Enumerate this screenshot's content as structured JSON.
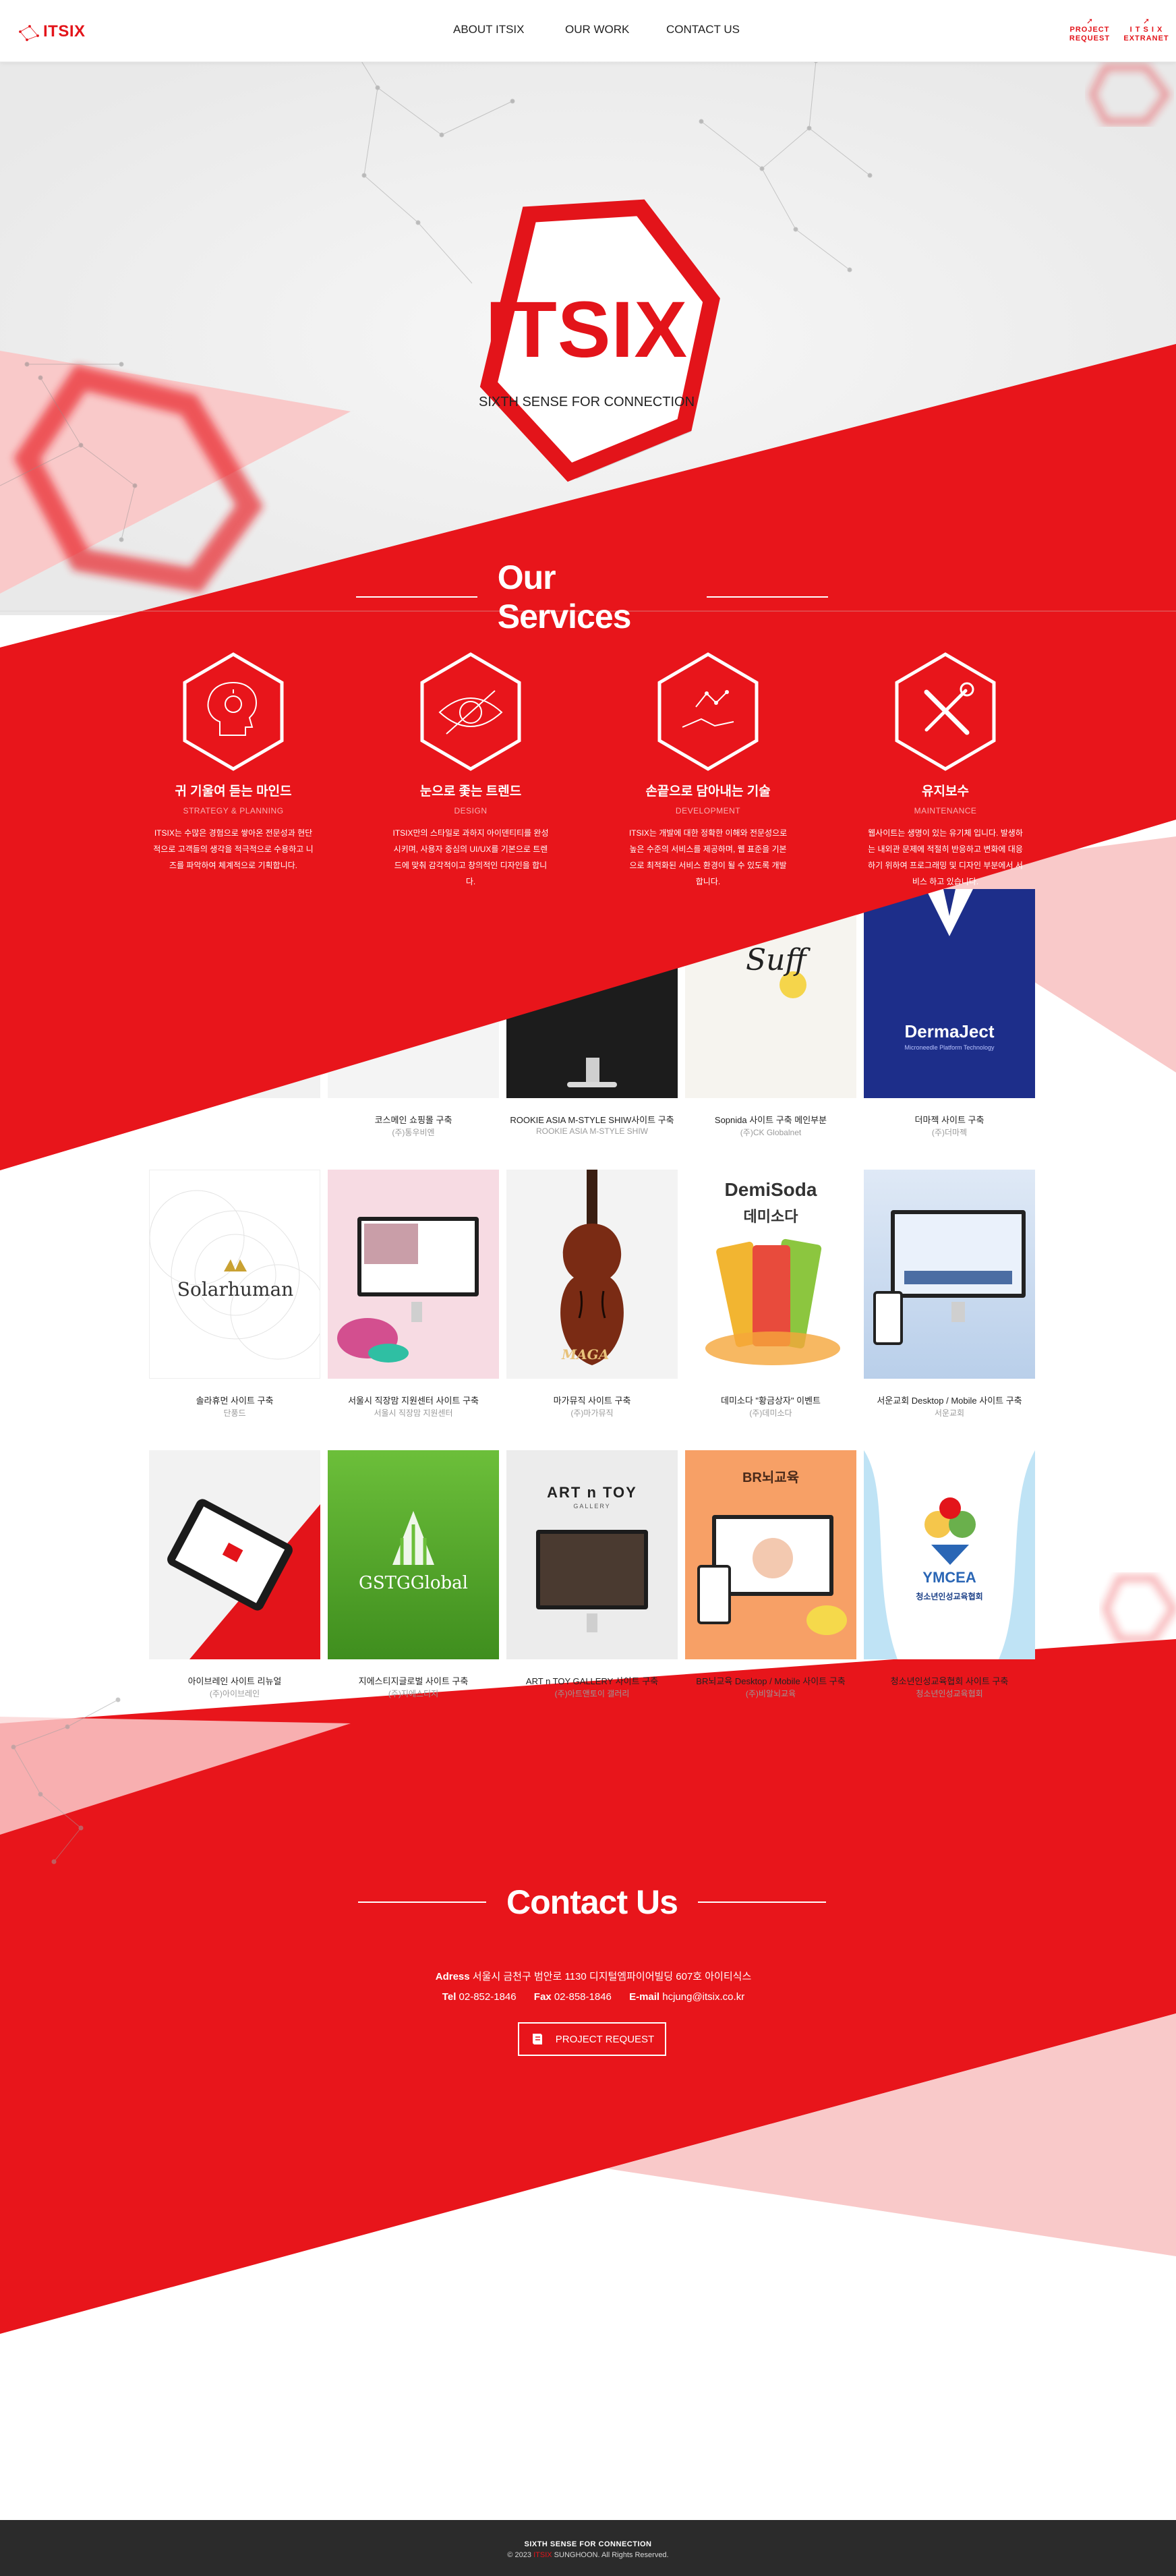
{
  "brand": {
    "logo_text": "ITSIX",
    "accent": "#e3141a",
    "light_red": "#f9c5c5"
  },
  "nav": {
    "items": [
      "ABOUT ITSIX",
      "OUR WORK",
      "CONTACT US"
    ]
  },
  "header_buttons": {
    "project_request": {
      "line1": "PROJECT",
      "line2": "REQUEST",
      "icon": "pointer-icon"
    },
    "extranet": {
      "line1": "I T S I X",
      "line2": "EXTRANET",
      "icon": "pointer-icon"
    }
  },
  "hero": {
    "title": "ITSIX",
    "subtitle": "SIXTH SENSE FOR CONNECTION"
  },
  "services": {
    "title": "Our Services",
    "items": [
      {
        "title": "귀 기울여 듣는 마인드",
        "subtitle": "STRATEGY & PLANNING",
        "icon": "head-idea-icon",
        "desc": "ITSIX는 수많은 경험으로 쌓아온 전문성과 현단적으로 고객들의 생각을 적극적으로 수용하고 니즈를 파악하여 체계적으로 기획합니다."
      },
      {
        "title": "눈으로 좇는 트렌드",
        "subtitle": "DESIGN",
        "icon": "eye-icon",
        "desc": "ITSIX만의 스타일로 과하지 아이덴티티를 완성시키며, 사용자 중심의 UI/UX를 기본으로 트렌드에 맞춰 감각적이고 창의적인 디자인을 합니다."
      },
      {
        "title": "손끝으로 담아내는 기술",
        "subtitle": "DEVELOPMENT",
        "icon": "hand-tech-icon",
        "desc": "ITSIX는 개발에 대한 정확한 이해와 전문성으로 높은 수준의 서비스를 제공하며, 웹 표준을 기본으로 최적화된 서비스 환경이 될 수 있도록 개발합니다."
      },
      {
        "title": "유지보수",
        "subtitle": "MAINTENANCE",
        "icon": "tools-icon",
        "desc": "웹사이트는 생명이 있는 유기체 입니다. 발생하는 내외관 문제에 적절히 반응하고 변화에 대응하기 위하여 프로그래밍 및 디자인 부분에서 서비스 하고 있습니다."
      }
    ]
  },
  "works": [
    {
      "name": "",
      "client": "",
      "theme": "hidden1"
    },
    {
      "name": "코스메인 쇼핑몰 구축",
      "client": "(주)통우비엔",
      "theme": "hidden2"
    },
    {
      "name": "ROOKIE ASIA M-STYLE SHIW사이트 구축",
      "client": "ROOKIE ASIA M-STYLE SHIW",
      "theme": "monitor-dark"
    },
    {
      "name": "Sopnida 사이트 구축 메인부분",
      "client": "(주)CK Globalnet",
      "theme": "sopnida"
    },
    {
      "name": "더마젝 사이트 구축",
      "client": "(주)더마젝",
      "theme": "dermaject",
      "logo": "DermaJect",
      "tag": "Microneedle Platform Technology"
    },
    {
      "name": "솔라휴먼 사이트 구축",
      "client": "단풍드",
      "theme": "solarhuman",
      "logo": "Solarhuman"
    },
    {
      "name": "서울시 직장맘 지원센터 사이트 구축",
      "client": "서울시 직장맘 지원센터",
      "theme": "pink-monitor"
    },
    {
      "name": "마가뮤직 사이트 구축",
      "client": "(주)마가뮤직",
      "theme": "violin",
      "logo": "MAGA"
    },
    {
      "name": "데미소다 \"황금상자\" 이벤트",
      "client": "(주)데미소다",
      "theme": "demisoda",
      "logo": "DemiSoda",
      "logo_kr": "데미소다",
      "can": "DemiSoda"
    },
    {
      "name": "서운교회 Desktop / Mobile 사이트 구축",
      "client": "서운교회",
      "theme": "sky-devices"
    },
    {
      "name": "아이브레인 사이트 리뉴얼",
      "client": "(주)아이브레인",
      "theme": "tablet-red"
    },
    {
      "name": "지에스티지글로벌 사이트 구축",
      "client": "(주)지에스티지",
      "theme": "gstg",
      "logo": "GSTGGlobal"
    },
    {
      "name": "ART n TOY GALLERY 사이트 구축",
      "client": "(주)아트앤토이 갤러리",
      "theme": "artntoy",
      "logo": "ART n TOY",
      "logo_sub": "GALLERY"
    },
    {
      "name": "BR뇌교육 Desktop / Mobile 사이트 구축",
      "client": "(주)비알뇌교육",
      "theme": "brain",
      "logo": "BR뇌교육"
    },
    {
      "name": "청소년인성교육협회 사이트 구축",
      "client": "청소년인성교육협회",
      "theme": "ymcea",
      "logo": "YMCEA",
      "logo_kr": "청소년인성교육협회"
    }
  ],
  "contact": {
    "title": "Contact Us",
    "address_label": "Adress",
    "address": "서울시 금천구 범안로 1130 디지털엠파이어빌딩 607호 아이티식스",
    "tel_label": "Tel",
    "tel": "02-852-1846",
    "fax_label": "Fax",
    "fax": "02-858-1846",
    "email_label": "E-mail",
    "email": "hcjung@itsix.co.kr",
    "button": "PROJECT REQUEST",
    "button_icon": "book-icon"
  },
  "footer": {
    "line1": "SIXTH SENSE FOR CONNECTION",
    "copyright_prefix": "© 2023",
    "brand": "ITSIX",
    "copyright_suffix": "SUNGHOON. All Rights Reserved."
  }
}
